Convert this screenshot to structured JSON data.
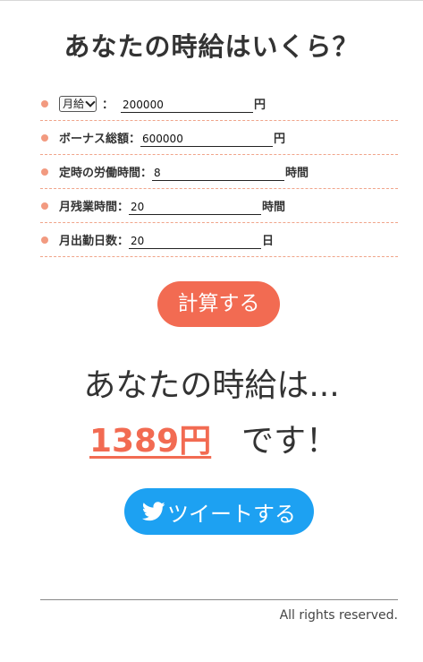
{
  "page": {
    "title": "あなたの時給はいくら？"
  },
  "form": {
    "rows": [
      {
        "select_value": "月給",
        "colon": "：",
        "value": "200000",
        "unit": "円"
      },
      {
        "label": "ボーナス総額：",
        "value": "600000",
        "unit": "円"
      },
      {
        "label": "定時の労働時間：",
        "value": "8",
        "unit": "時間"
      },
      {
        "label": "月残業時間：",
        "value": "20",
        "unit": "時間"
      },
      {
        "label": "月出勤日数：",
        "value": "20",
        "unit": "日"
      }
    ]
  },
  "actions": {
    "calculate_label": "計算する",
    "tweet_label": "ツイートする"
  },
  "result": {
    "heading": "あなたの時給は...",
    "amount": "1389円",
    "suffix": "です！"
  },
  "footer": {
    "text": "All rights reserved."
  },
  "colors": {
    "accent": "#f26b52",
    "dot": "#f29a80",
    "twitter": "#1da1f2"
  },
  "icons": {
    "tweet": "twitter-bird-icon",
    "select": "chevron-down-icon"
  }
}
